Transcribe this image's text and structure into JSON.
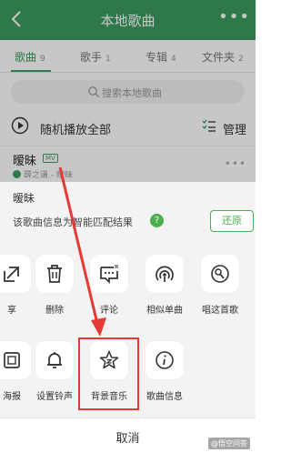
{
  "header": {
    "title": "本地歌曲",
    "back_icon": "chevron-left-icon",
    "more_label": "•••"
  },
  "tabs": [
    {
      "label": "歌曲",
      "count": "9"
    },
    {
      "label": "歌手",
      "count": "1"
    },
    {
      "label": "专辑",
      "count": "4"
    },
    {
      "label": "文件夹",
      "count": "2"
    }
  ],
  "search": {
    "placeholder": "搜索本地歌曲"
  },
  "playbar": {
    "label": "随机播放全部",
    "manage": "管理"
  },
  "song": {
    "name": "暧昧",
    "badge": "MV",
    "meta": "薛之谦 - 暧昧"
  },
  "sheet": {
    "title": "暧昧",
    "info": "该歌曲信息为智能匹配结果",
    "help": "?",
    "restore": "还原",
    "row1": [
      {
        "label": "享",
        "icon": "share-icon"
      },
      {
        "label": "删除",
        "icon": "trash-icon"
      },
      {
        "label": "评论",
        "icon": "comment-icon"
      },
      {
        "label": "相似单曲",
        "icon": "similar-icon"
      },
      {
        "label": "唱这首歌",
        "icon": "sing-icon"
      }
    ],
    "row2": [
      {
        "label": "海报",
        "icon": "poster-icon"
      },
      {
        "label": "设置铃声",
        "icon": "bell-icon"
      },
      {
        "label": "背景音乐",
        "icon": "star-music-icon"
      },
      {
        "label": "歌曲信息",
        "icon": "info-icon"
      }
    ],
    "cancel": "取消"
  },
  "watermark": "@悟空问答",
  "colors": {
    "brand": "#3c9a5f",
    "accent": "#4caf50",
    "highlight": "#e53935"
  }
}
